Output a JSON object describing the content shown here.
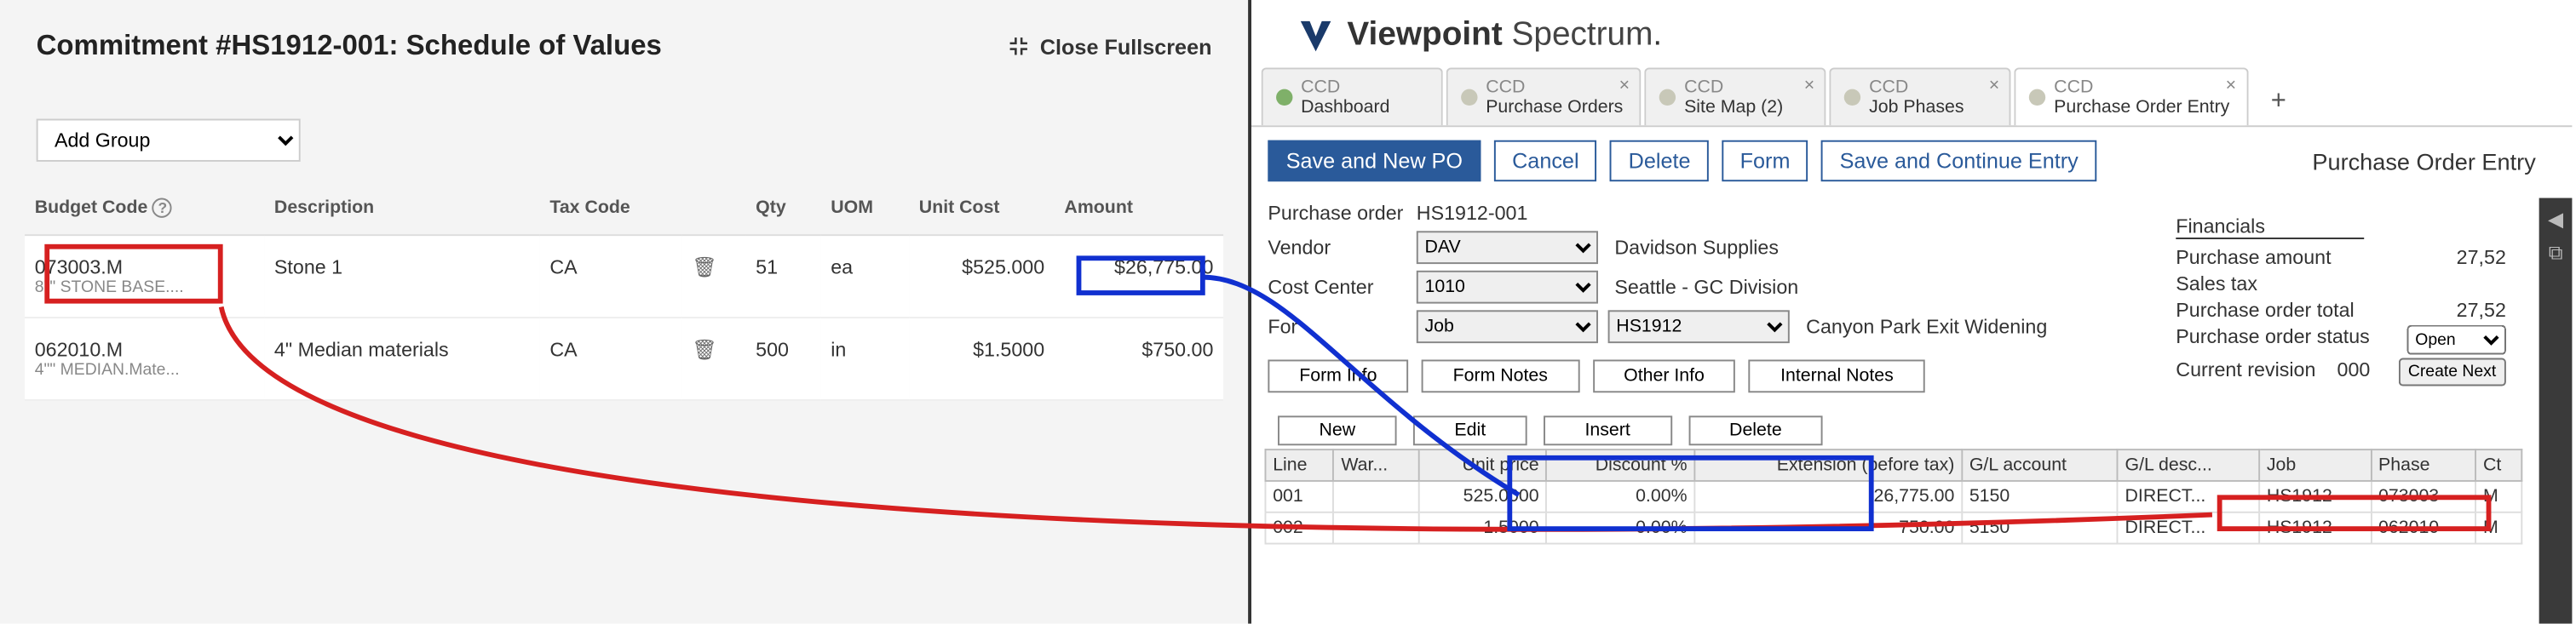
{
  "left": {
    "title": "Commitment #HS1912-001: Schedule of Values",
    "close": "Close Fullscreen",
    "add_group": "Add Group",
    "headers": {
      "budget_code": "Budget Code",
      "description": "Description",
      "tax_code": "Tax Code",
      "qty": "Qty",
      "uom": "UOM",
      "unit_cost": "Unit Cost",
      "amount": "Amount"
    },
    "rows": [
      {
        "code": "073003.M",
        "code_sub": "8\"\" STONE BASE....",
        "desc": "Stone 1",
        "tax": "CA",
        "qty": "51",
        "uom": "ea",
        "unit": "$525.000",
        "amount": "$26,775.00"
      },
      {
        "code": "062010.M",
        "code_sub": "4\"\" MEDIAN.Mate...",
        "desc": "4\" Median materials",
        "tax": "CA",
        "qty": "500",
        "uom": "in",
        "unit": "$1.5000",
        "amount": "$750.00"
      }
    ]
  },
  "right": {
    "logo": {
      "bold": "Viewpoint",
      "light": " Spectrum",
      "dot": "."
    },
    "tabs": [
      {
        "co": "CCD",
        "name": "Dashboard",
        "color": "gr",
        "close": false
      },
      {
        "co": "CCD",
        "name": "Purchase Orders",
        "color": "gy",
        "close": true
      },
      {
        "co": "CCD",
        "name": "Site Map (2)",
        "color": "gy",
        "close": true
      },
      {
        "co": "CCD",
        "name": "Job Phases",
        "color": "gy",
        "close": true
      },
      {
        "co": "CCD",
        "name": "Purchase Order Entry",
        "color": "gy",
        "close": true,
        "active": true
      }
    ],
    "toolbar": {
      "save_new": "Save and New PO",
      "cancel": "Cancel",
      "delete": "Delete",
      "form": "Form",
      "save_cont": "Save and Continue Entry",
      "title": "Purchase Order Entry"
    },
    "form": {
      "po_label": "Purchase order",
      "po": "HS1912-001",
      "vendor_label": "Vendor",
      "vendor": "DAV",
      "vendor_desc": "Davidson Supplies",
      "cc_label": "Cost Center",
      "cc": "1010",
      "cc_desc": "Seattle - GC Division",
      "for_label": "For",
      "for": "Job",
      "job": "HS1912",
      "job_desc": "Canyon Park Exit Widening"
    },
    "fin": {
      "header": "Financials",
      "po_amt_l": "Purchase amount",
      "po_amt": "27,52",
      "tax_l": "Sales tax",
      "tax": "",
      "tot_l": "Purchase order total",
      "tot": "27,52",
      "status_l": "Purchase order status",
      "status": "Open",
      "rev_l": "Current revision",
      "rev": "000",
      "create_next": "Create Next"
    },
    "info_btns": [
      "Form Info",
      "Form Notes",
      "Other Info",
      "Internal Notes"
    ],
    "mini": {
      "new": "New",
      "edit": "Edit",
      "insert": "Insert",
      "delete": "Delete"
    },
    "grid": {
      "headers": [
        "Line",
        "War...",
        "Unit price",
        "Discount %",
        "Extension (before tax)",
        "G/L account",
        "G/L desc...",
        "Job",
        "Phase",
        "Ct"
      ],
      "rows": [
        {
          "line": "001",
          "war": "",
          "unit": "525.0000",
          "disc": "0.00%",
          "ext": "26,775.00",
          "gl": "5150",
          "gld": "DIRECT...",
          "job": "HS1912",
          "phase": "073003",
          "ct": "M"
        },
        {
          "line": "002",
          "war": "",
          "unit": "1.5000",
          "disc": "0.00%",
          "ext": "750.00",
          "gl": "5150",
          "gld": "DIRECT...",
          "job": "HS1912",
          "phase": "062010",
          "ct": "M"
        }
      ]
    }
  }
}
